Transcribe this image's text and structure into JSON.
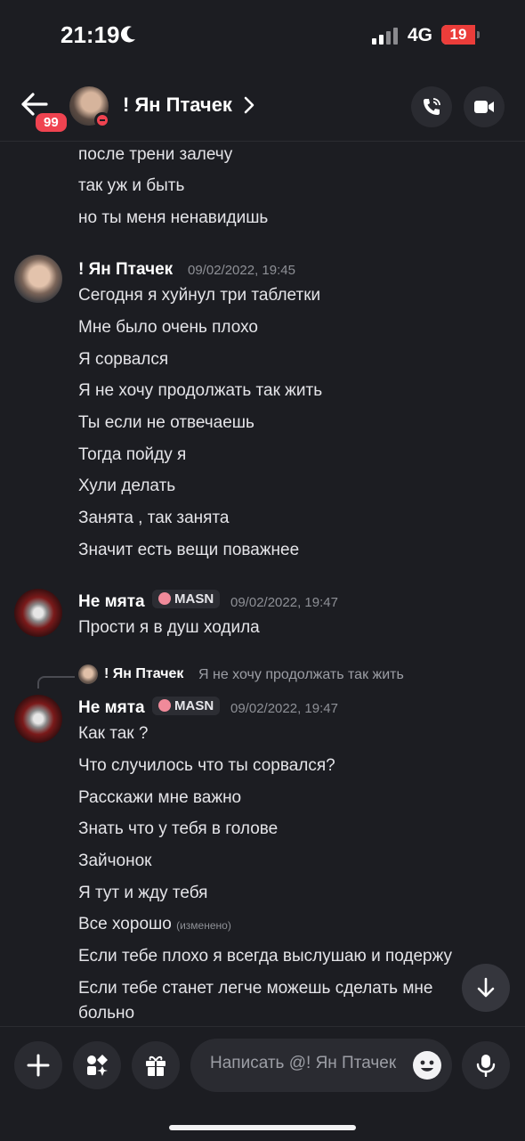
{
  "status_bar": {
    "time": "21:19",
    "network": "4G",
    "battery": "19"
  },
  "header": {
    "unread_badge": "99",
    "channel_name": "! Ян Птачек",
    "icons": [
      "back-arrow-icon",
      "chevron-right-icon",
      "phone-call-icon",
      "video-camera-icon"
    ]
  },
  "continuation": {
    "lines": [
      "после трени залечу",
      "так уж и быть",
      "но ты меня ненавидишь"
    ]
  },
  "messages": [
    {
      "author": "! Ян Птачек",
      "timestamp": "09/02/2022, 19:45",
      "lines": [
        "Сегодня я хуйнул три таблетки",
        "Мне было очень плохо",
        "Я сорвался",
        "Я не хочу продолжать так жить",
        "Ты если не отвечаешь",
        "Тогда пойду я",
        "Хули делать",
        "Занята , так занята",
        "Значит есть вещи поважнее"
      ]
    },
    {
      "author": "Не мята",
      "role": "MASN",
      "timestamp": "09/02/2022, 19:47",
      "lines": [
        "Прости я в душ ходила"
      ]
    },
    {
      "reply_to": {
        "author": "! Ян Птачек",
        "text": "Я не хочу продолжать так жить"
      },
      "author": "Не мята",
      "role": "MASN",
      "timestamp": "09/02/2022, 19:47",
      "lines": [
        "Как так ?",
        "Что случилось что ты сорвался?",
        "Расскажи мне важно",
        "Знать что у тебя в голове",
        "Зайчонок",
        "Я тут и жду тебя",
        "Все хорошо",
        "Если тебе плохо я всегда выслушаю и подержу",
        "Если тебе станет легче можешь сделать мне",
        "больно"
      ],
      "edited_label": "(изменено)"
    }
  ],
  "composer": {
    "placeholder": "Написать @! Ян Птачек",
    "icons": [
      "plus-icon",
      "apps-icon",
      "gift-icon",
      "emoji-icon",
      "microphone-icon"
    ]
  }
}
